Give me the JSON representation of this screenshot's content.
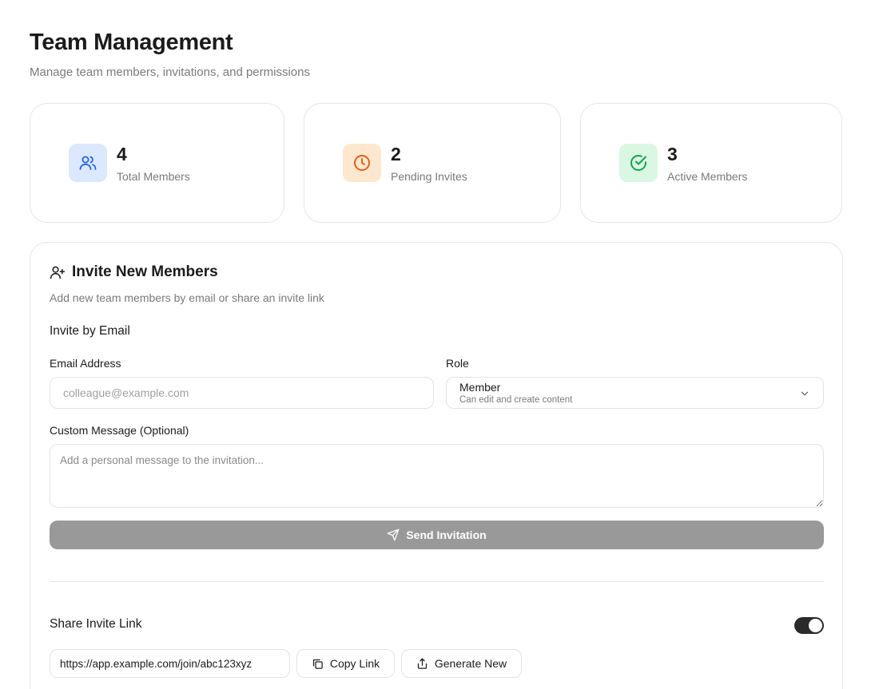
{
  "header": {
    "title": "Team Management",
    "subtitle": "Manage team members, invitations, and permissions"
  },
  "stats": [
    {
      "value": "4",
      "label": "Total Members",
      "icon": "users-icon",
      "color": "#2563eb",
      "bg": "#dce8fd"
    },
    {
      "value": "2",
      "label": "Pending Invites",
      "icon": "clock-icon",
      "color": "#ea580c",
      "bg": "#fde8cf"
    },
    {
      "value": "3",
      "label": "Active Members",
      "icon": "check-circle-icon",
      "color": "#16a34a",
      "bg": "#d9f7e2"
    }
  ],
  "invite": {
    "title": "Invite New Members",
    "description": "Add new team members by email or share an invite link",
    "email_section_title": "Invite by Email",
    "email_label": "Email Address",
    "email_placeholder": "colleague@example.com",
    "email_value": "",
    "role_label": "Role",
    "role_value": "Member",
    "role_hint": "Can edit and create content",
    "message_label": "Custom Message (Optional)",
    "message_placeholder": "Add a personal message to the invitation...",
    "message_value": "",
    "send_label": "Send Invitation",
    "share_title": "Share Invite Link",
    "share_enabled": true,
    "invite_link": "https://app.example.com/join/abc123xyz",
    "copy_label": "Copy Link",
    "generate_label": "Generate New"
  },
  "colors": {
    "send_button_disabled": "#999999",
    "toggle_on": "#2b2b2b",
    "border": "#e6e6e6"
  }
}
